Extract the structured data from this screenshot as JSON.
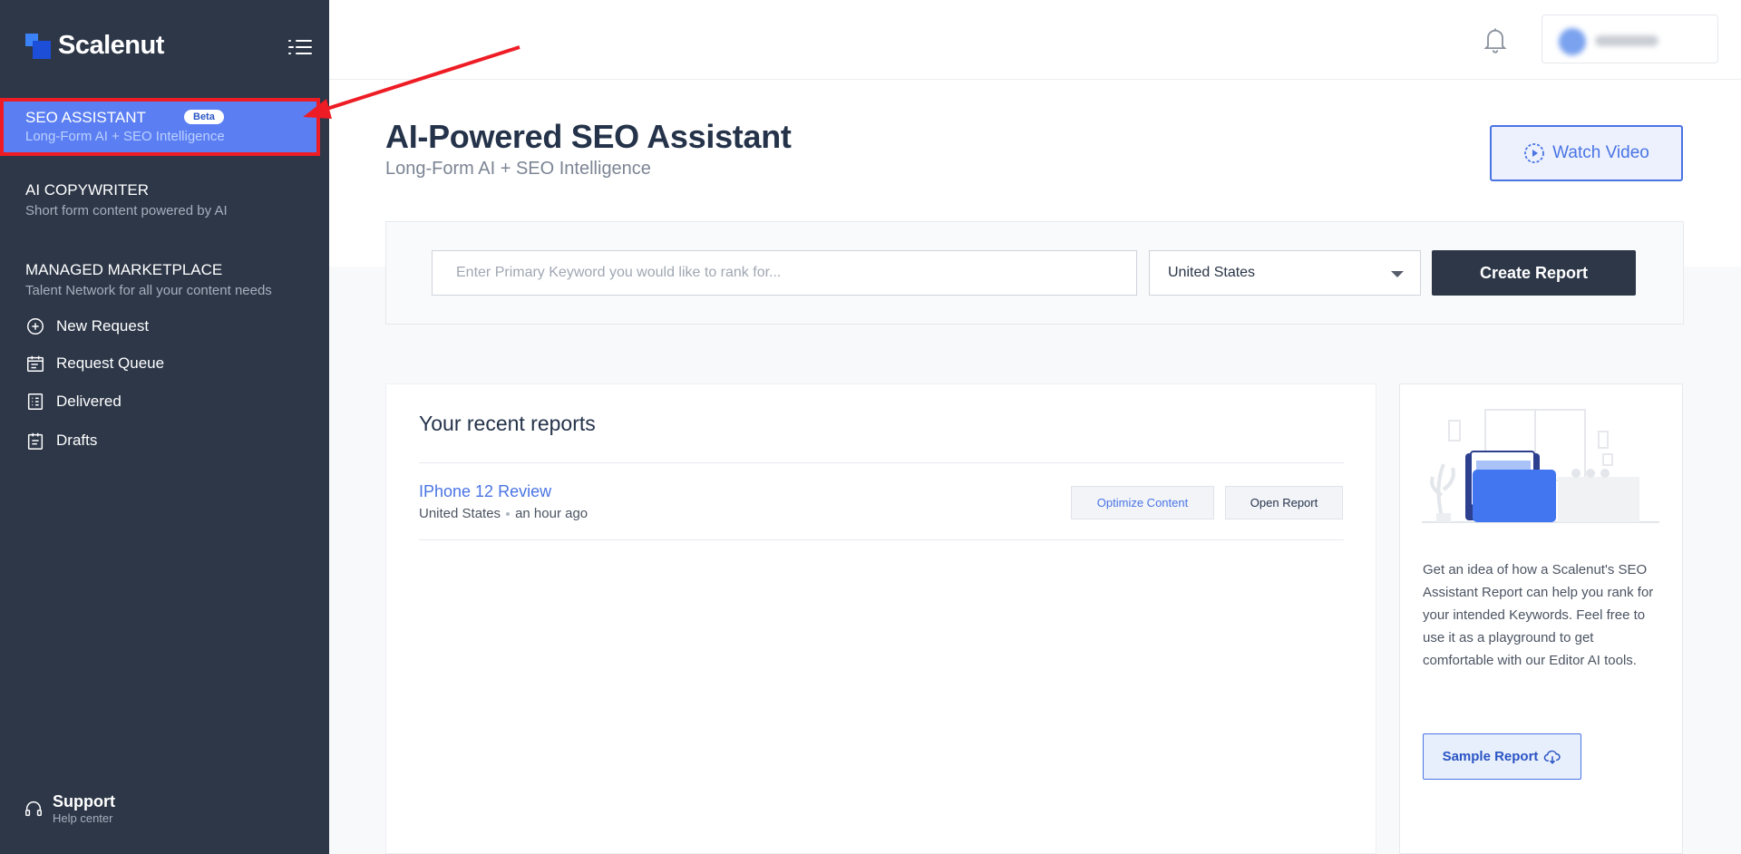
{
  "app": {
    "logo_text": "Scalenut"
  },
  "sidebar": {
    "active": {
      "title": "SEO ASSISTANT",
      "badge": "Beta",
      "subtitle": "Long-Form AI + SEO Intelligence"
    },
    "copywriter": {
      "title": "AI COPYWRITER",
      "subtitle": "Short form content powered by AI"
    },
    "marketplace": {
      "title": "MANAGED MARKETPLACE",
      "subtitle": "Talent Network for all your content needs",
      "items": [
        {
          "label": "New Request",
          "icon": "plus-circle-icon"
        },
        {
          "label": "Request Queue",
          "icon": "calendar-list-icon"
        },
        {
          "label": "Delivered",
          "icon": "checklist-icon"
        },
        {
          "label": "Drafts",
          "icon": "clipboard-icon"
        }
      ]
    },
    "support": {
      "title": "Support",
      "subtitle": "Help center"
    }
  },
  "main": {
    "title": "AI-Powered SEO Assistant",
    "subtitle": "Long-Form AI + SEO Intelligence",
    "watch_video_label": "Watch Video",
    "search": {
      "placeholder": "Enter Primary Keyword you would like to rank for...",
      "value": "",
      "country": "United States",
      "create_label": "Create Report"
    },
    "recent": {
      "title": "Your recent reports",
      "reports": [
        {
          "name": "IPhone 12 Review",
          "country": "United States",
          "time": "an hour ago",
          "optimize_label": "Optimize Content",
          "open_label": "Open Report"
        }
      ]
    },
    "sample": {
      "description": "Get an idea of how a Scalenut's SEO Assistant Report can help you rank for your intended Keywords. Feel free to use it as a playground to get comfortable with our Editor AI tools.",
      "button_label": "Sample Report"
    }
  },
  "colors": {
    "sidebar_bg": "#2d3748",
    "active_nav": "#5b7ff2",
    "accent": "#4a74e4",
    "annotation_red": "#ee1c25"
  }
}
